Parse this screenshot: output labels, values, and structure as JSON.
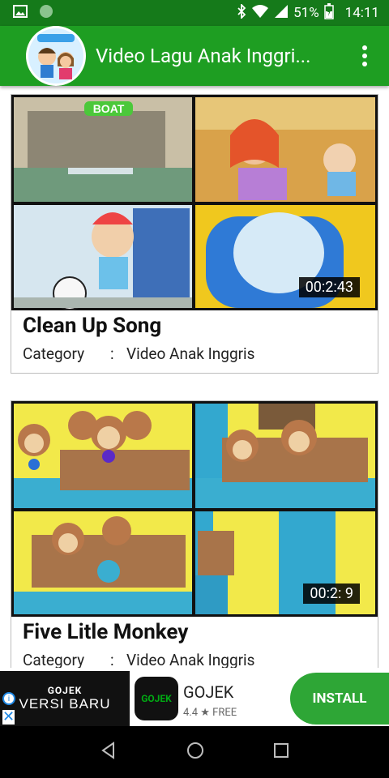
{
  "status_bar": {
    "battery": "51%",
    "time": "14:11"
  },
  "app_bar": {
    "title": "Video Lagu Anak Inggri..."
  },
  "videos": [
    {
      "title": "Clean Up Song",
      "duration": "00:2:43",
      "category_label": "Category",
      "separator": ":",
      "category_value": "Video Anak Inggris",
      "thumb_caption": "BOAT"
    },
    {
      "title": "Five Litle Monkey",
      "duration": "00:2: 9",
      "category_label": "Category",
      "separator": ":",
      "category_value": "Video Anak Inggris"
    }
  ],
  "ad": {
    "image_brand": "GOJEK",
    "image_subtitle": "VERSI BARU",
    "app_icon_text": "GOJEK",
    "app_name": "GOJEK",
    "rating": "4.4 ★ FREE",
    "install_label": "INSTALL"
  }
}
